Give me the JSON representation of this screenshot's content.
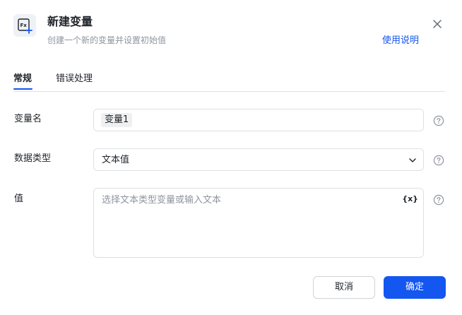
{
  "dialog": {
    "title": "新建变量",
    "subtitle": "创建一个新的变量并设置初始值",
    "help_link": "使用说明",
    "header_icon": "function-variable-icon",
    "close_icon": "close-icon"
  },
  "tabs": [
    {
      "label": "常规",
      "active": true
    },
    {
      "label": "错误处理",
      "active": false
    }
  ],
  "form": {
    "name": {
      "label": "变量名",
      "value": "变量1"
    },
    "type": {
      "label": "数据类型",
      "value": "文本值"
    },
    "value": {
      "label": "值",
      "placeholder": "选择文本类型变量或输入文本",
      "var_button": "{x}"
    }
  },
  "footer": {
    "cancel_label": "取消",
    "ok_label": "确定"
  },
  "colors": {
    "primary": "#1456f0",
    "text": "#1f2329",
    "muted": "#8f959e",
    "border": "#dee0e3"
  }
}
